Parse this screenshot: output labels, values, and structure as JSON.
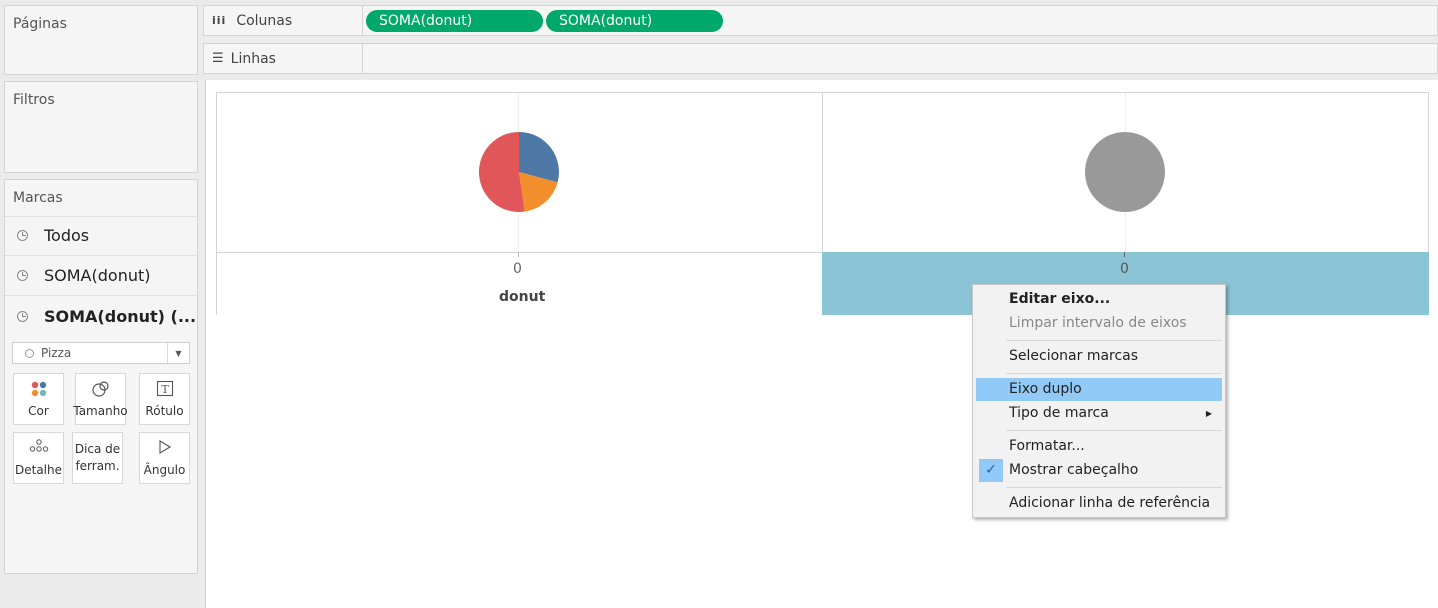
{
  "panels": {
    "pages_title": "Páginas",
    "filters_title": "Filtros",
    "marks_title": "Marcas"
  },
  "marks": {
    "rows": [
      {
        "label": "Todos"
      },
      {
        "label": "SOMA(donut)"
      },
      {
        "label": "SOMA(donut) (..."
      }
    ],
    "mark_type": "Pizza",
    "buttons": {
      "color": "Cor",
      "size": "Tamanho",
      "label": "Rótulo",
      "detail": "Detalhe",
      "tooltip": "Dica de\nferram.",
      "angle": "Ângulo"
    }
  },
  "shelves": {
    "columns_label": "Colunas",
    "rows_label": "Linhas",
    "column_pills": [
      "SOMA(donut)",
      "SOMA(donut)"
    ]
  },
  "viz": {
    "left_axis_tick": "0",
    "right_axis_tick": "0",
    "axis_title": "donut",
    "pie_colors": {
      "blue": "#4e79a7",
      "orange": "#f28e2b",
      "red": "#e15759"
    },
    "gray_circle_color": "#999999",
    "selected_axis_color": "#8bc4d4"
  },
  "context_menu": {
    "items": {
      "edit_axis": "Editar eixo...",
      "clear_range": "Limpar intervalo de eixos",
      "select_marks": "Selecionar marcas",
      "dual_axis": "Eixo duplo",
      "mark_type": "Tipo de marca",
      "format": "Formatar...",
      "show_header": "Mostrar cabeçalho",
      "add_ref_line": "Adicionar linha de referência"
    }
  },
  "colors": {
    "pill_green": "#00a86b",
    "menu_highlight": "#91c9f7"
  }
}
